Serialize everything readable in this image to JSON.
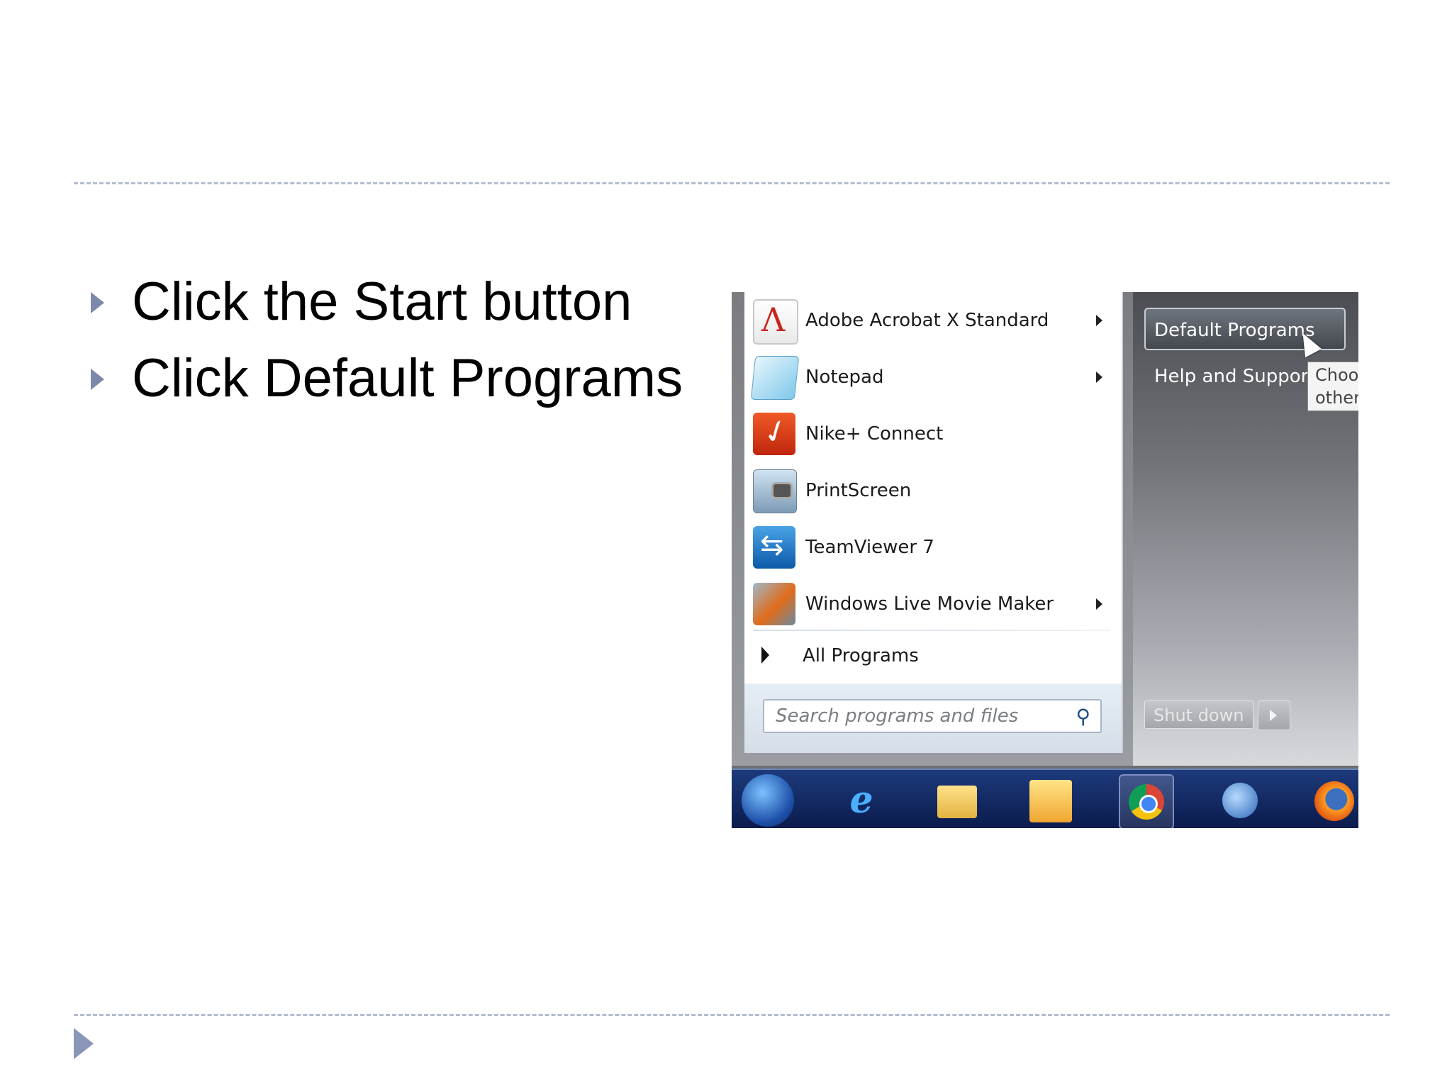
{
  "slide": {
    "bullets": [
      "Click the Start button",
      "Click Default Programs"
    ]
  },
  "start_menu": {
    "programs": [
      {
        "label": "Adobe Acrobat X Standard",
        "icon": "acrobat-icon",
        "has_submenu": true
      },
      {
        "label": "Notepad",
        "icon": "notepad-icon",
        "has_submenu": true
      },
      {
        "label": "Nike+ Connect",
        "icon": "nike-icon",
        "has_submenu": false
      },
      {
        "label": "PrintScreen",
        "icon": "printscreen-icon",
        "has_submenu": false
      },
      {
        "label": "TeamViewer 7",
        "icon": "teamviewer-icon",
        "has_submenu": false
      },
      {
        "label": "Windows Live Movie Maker",
        "icon": "moviemaker-icon",
        "has_submenu": true
      }
    ],
    "all_programs": "All Programs",
    "search_placeholder": "Search programs and files",
    "right": {
      "default_programs": "Default Programs",
      "help_support": "Help and Support",
      "tooltip_line1": "Choose",
      "tooltip_line2": "other a",
      "shutdown": "Shut down"
    }
  },
  "taskbar": {
    "icons": [
      "start-orb-icon",
      "internet-explorer-icon",
      "windows-explorer-icon",
      "outlook-icon",
      "chrome-icon",
      "thunderbird-icon",
      "firefox-icon"
    ],
    "active": "chrome-icon"
  }
}
